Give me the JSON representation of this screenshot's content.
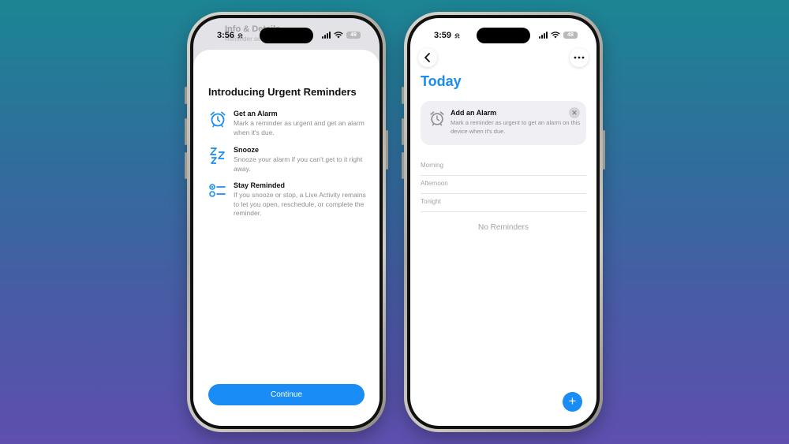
{
  "left_phone": {
    "time": "3:56",
    "battery": "49",
    "background_title": "Info & Details",
    "background_subtitle": "Reminder settings",
    "sheet_title": "Introducing Urgent Reminders",
    "features": [
      {
        "title": "Get an Alarm",
        "description": "Mark a reminder as urgent and get an alarm when it's due.",
        "icon": "alarm-clock-icon"
      },
      {
        "title": "Snooze",
        "description": "Snooze your alarm if you can't get to it right away.",
        "icon": "zzz-icon"
      },
      {
        "title": "Stay Reminded",
        "description": "If you snooze or stop, a Live Activity remains to let you open, reschedule, or complete the reminder.",
        "icon": "list-checklist-icon"
      }
    ],
    "continue_label": "Continue"
  },
  "right_phone": {
    "time": "3:59",
    "battery": "48",
    "title": "Today",
    "card": {
      "title": "Add an Alarm",
      "description": "Mark a reminder as urgent to get an alarm on this device when it's due.",
      "close_glyph": "✕"
    },
    "sections": [
      "Morning",
      "Afternoon",
      "Tonight"
    ],
    "empty_text": "No Reminders",
    "add_glyph": "+",
    "more_glyph": "•••",
    "back_glyph": "‹"
  },
  "colors": {
    "accent": "#1a8cf5",
    "background_top": "#1c8593",
    "background_bottom": "#5e4fae"
  }
}
